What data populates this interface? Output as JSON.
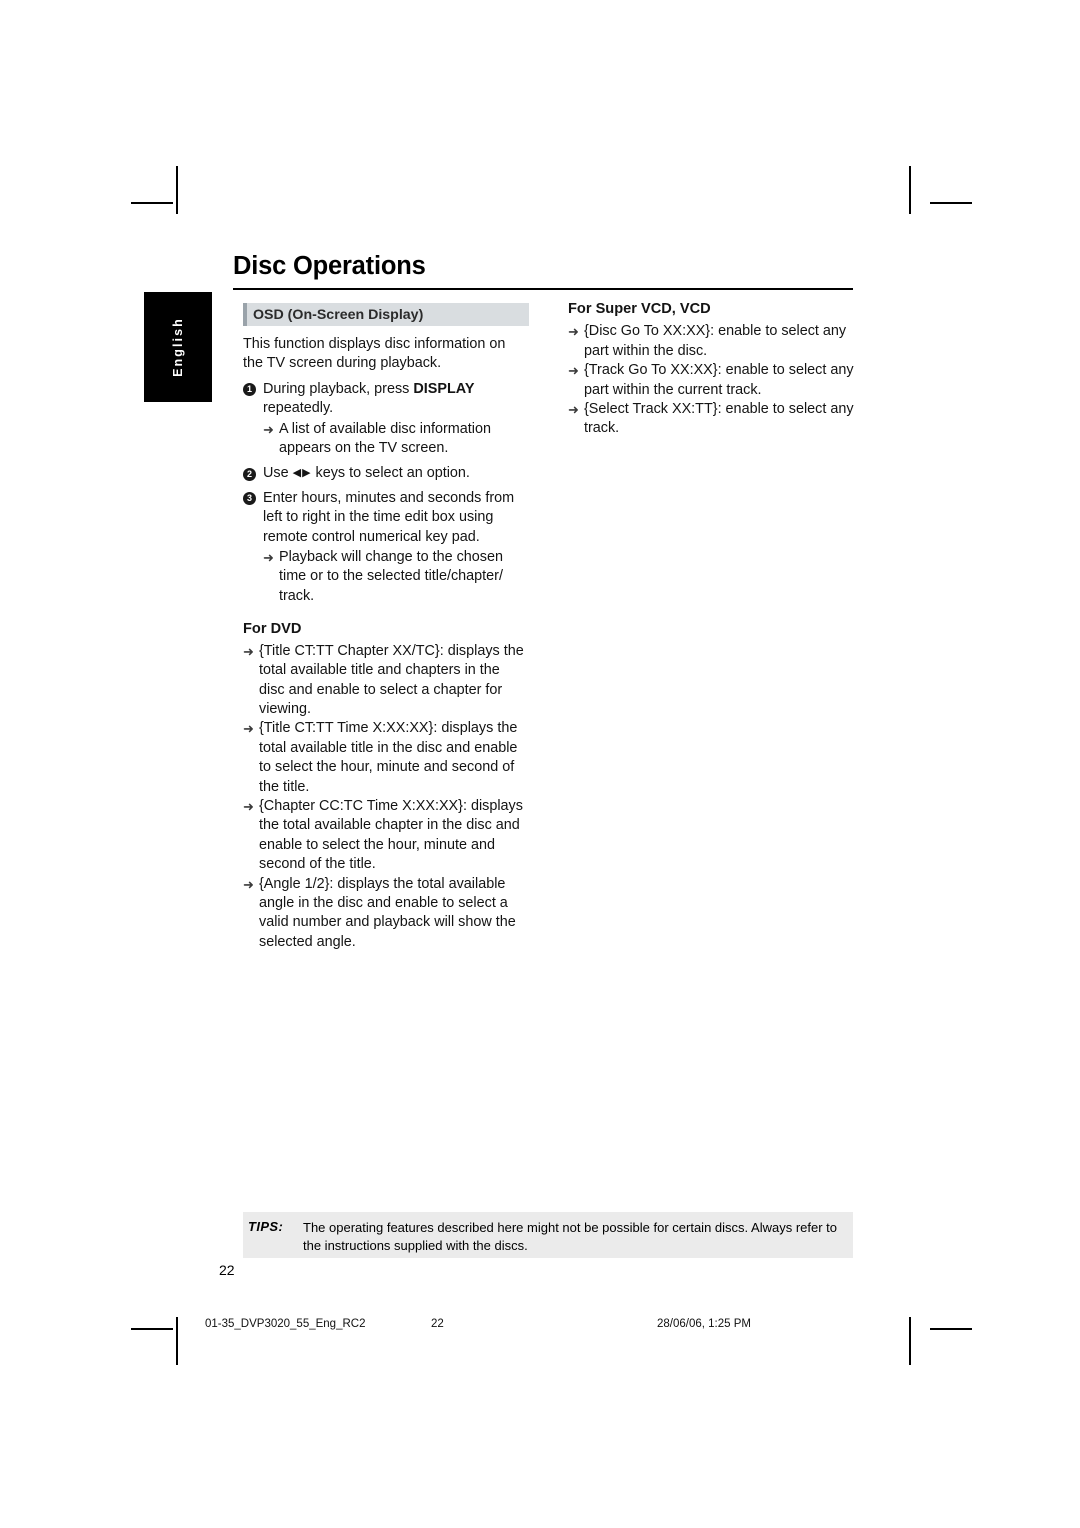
{
  "page": {
    "title": "Disc Operations",
    "language_tab": "English",
    "page_number": "22"
  },
  "left_column": {
    "section_title": "OSD (On-Screen Display)",
    "intro": "This function displays disc information on the TV screen during playback.",
    "steps": [
      {
        "num": "1",
        "text_before": "During playback, press ",
        "bold": "DISPLAY",
        "text_after": " repeatedly."
      },
      {
        "num": "2",
        "text_before": "Use ",
        "bold": "",
        "text_after": " keys to select an option."
      },
      {
        "num": "3",
        "text_before": "Enter hours, minutes and seconds from left to right in the time edit box using remote control numerical key pad.",
        "bold": "",
        "text_after": ""
      }
    ],
    "step1_arrow": "A list of available disc information appears on the TV screen.",
    "step3_arrow": "Playback will change to the chosen time or to the selected title/chapter/ track.",
    "dvd_heading": "For DVD",
    "dvd_items": [
      "{Title CT:TT Chapter XX/TC}: displays the total available title and chapters in the disc and enable to select a chapter for viewing.",
      "{Title CT:TT Time X:XX:XX}: displays the total available title in the disc and enable to select the hour, minute and second of the title.",
      "{Chapter CC:TC Time X:XX:XX}: displays the total available chapter in the disc and enable to select the hour, minute and second of the title.",
      "{Angle 1/2}: displays the total available angle in the disc and enable to select a valid number and playback will show the selected angle."
    ]
  },
  "right_column": {
    "heading": "For Super VCD, VCD",
    "items": [
      "{Disc Go To XX:XX}: enable to select any part within the disc.",
      "{Track Go To XX:XX}: enable to select any part within the current track.",
      "{Select Track XX:TT}: enable to select any track."
    ]
  },
  "tips": {
    "label": "TIPS:",
    "text": "The operating features described here might not be possible for certain discs.  Always refer to the instructions supplied with the discs."
  },
  "footer": {
    "file": "01-35_DVP3020_55_Eng_RC2",
    "page": "22",
    "date": "28/06/06, 1:25 PM"
  },
  "icons": {
    "arrow": "➜",
    "left_triangle": "◀",
    "right_triangle": "▶"
  }
}
